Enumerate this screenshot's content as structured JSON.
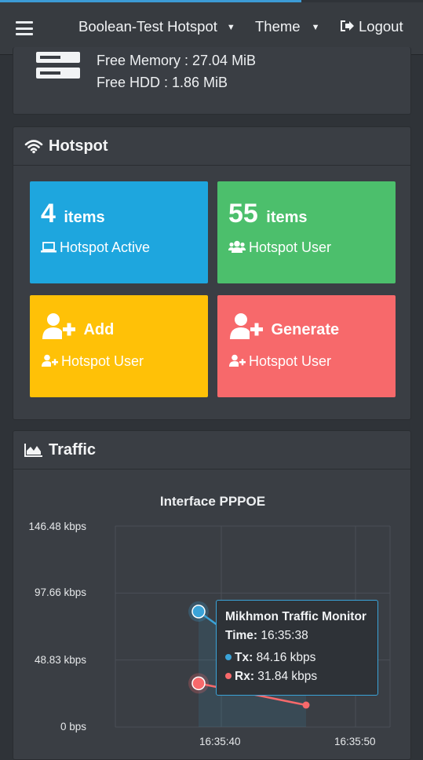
{
  "header": {
    "hotspot_name": "Boolean-Test Hotspot",
    "theme_label": "Theme",
    "logout_label": "Logout"
  },
  "system": {
    "free_memory": "Free Memory : 27.04 MiB",
    "free_hdd": "Free HDD : 1.86 MiB"
  },
  "hotspot_card": {
    "title": "Hotspot",
    "tiles": [
      {
        "count": "4",
        "unit": "items",
        "label": "Hotspot Active",
        "color": "#1ea6de"
      },
      {
        "count": "55",
        "unit": "items",
        "label": "Hotspot User",
        "color": "#4cbf6c"
      },
      {
        "count": "",
        "unit": "Add",
        "label": "Hotspot User",
        "color": "#ffc107"
      },
      {
        "count": "",
        "unit": "Generate",
        "label": "Hotspot User",
        "color": "#f7696b"
      }
    ]
  },
  "traffic_card": {
    "title": "Traffic"
  },
  "chart_data": {
    "type": "line",
    "title": "Interface PPPOE",
    "y_ticks": [
      "146.48 kbps",
      "97.66 kbps",
      "48.83 kbps",
      "0 bps"
    ],
    "x_ticks": [
      "16:35:40",
      "16:35:50"
    ],
    "ylim": [
      0,
      146.48
    ],
    "y_unit": "kbps",
    "grid": true,
    "series": [
      {
        "name": "Tx",
        "color": "#3aa3d8",
        "values": [
          84.16,
          28
        ]
      },
      {
        "name": "Rx",
        "color": "#f7696b",
        "values": [
          31.84,
          16
        ]
      }
    ],
    "x": [
      "16:35:38",
      "16:35:46"
    ]
  },
  "tooltip": {
    "title": "Mikhmon Traffic Monitor",
    "time_label": "Time:",
    "time_value": "16:35:38",
    "tx_label": "Tx:",
    "tx_value": "84.16 kbps",
    "rx_label": "Rx:",
    "rx_value": "31.84 kbps"
  },
  "colors": {
    "accent": "#3aa3d8",
    "background": "#2f3338",
    "card": "#3a3e44"
  }
}
